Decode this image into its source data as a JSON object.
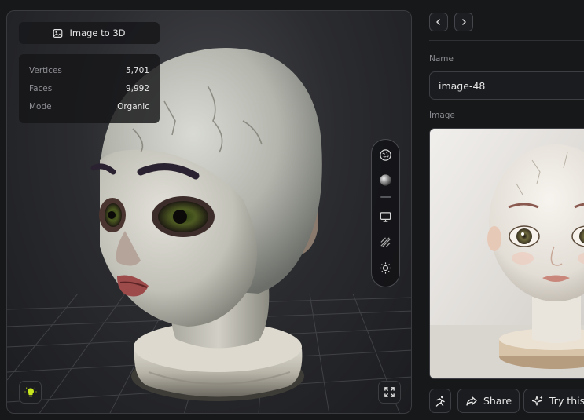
{
  "viewer": {
    "title": "Image to 3D",
    "stats": [
      {
        "label": "Vertices",
        "value": "5,701"
      },
      {
        "label": "Faces",
        "value": "9,992"
      },
      {
        "label": "Mode",
        "value": "Organic"
      }
    ],
    "tools": [
      {
        "icon": "texture-sphere-icon"
      },
      {
        "icon": "solid-sphere-icon"
      },
      {
        "icon": "monitor-icon"
      },
      {
        "icon": "wireframe-icon"
      },
      {
        "icon": "sun-icon"
      }
    ],
    "light_icon": "lightbulb-icon",
    "fullscreen_icon": "expand-icon"
  },
  "panel": {
    "name_label": "Name",
    "name_value": "image-48",
    "image_label": "Image",
    "actions": {
      "animate_icon": "running-figure-icon",
      "share_label": "Share",
      "try_label": "Try this"
    }
  },
  "colors": {
    "background": "#17181a",
    "accent": "#c8e61e"
  }
}
